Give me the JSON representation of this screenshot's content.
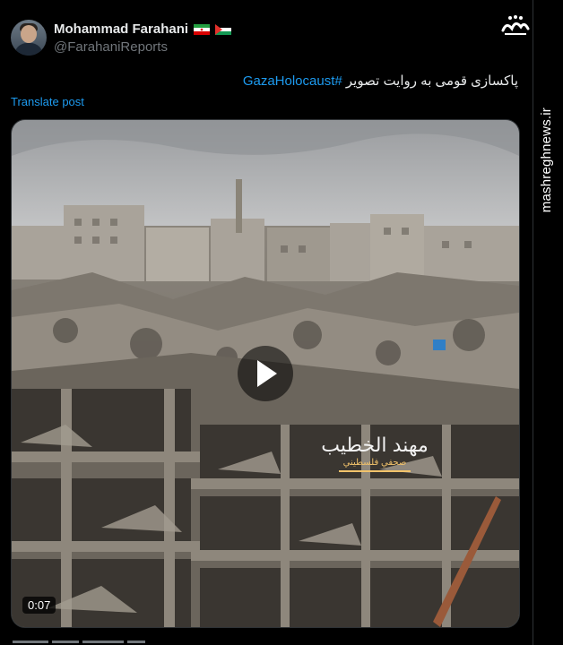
{
  "author": {
    "name": "Mohammad Farahani",
    "handle": "@FarahaniReports",
    "flags": [
      "iran-flag-icon",
      "palestine-flag-icon"
    ]
  },
  "tweet": {
    "text": "پاکسازی قومی به روایت تصویر",
    "hashtag": "#GazaHolocaust",
    "translate_label": "Translate post"
  },
  "video": {
    "duration": "0:07",
    "caption_name": "مهند الخطيب",
    "caption_title": "صحفي فلسطيني"
  },
  "watermark": {
    "site": "mashreghnews.ir",
    "logo": "mashregh-logo-icon"
  },
  "colors": {
    "background": "#000000",
    "text": "#e7e9ea",
    "muted": "#71767b",
    "link": "#1d9bf0"
  }
}
